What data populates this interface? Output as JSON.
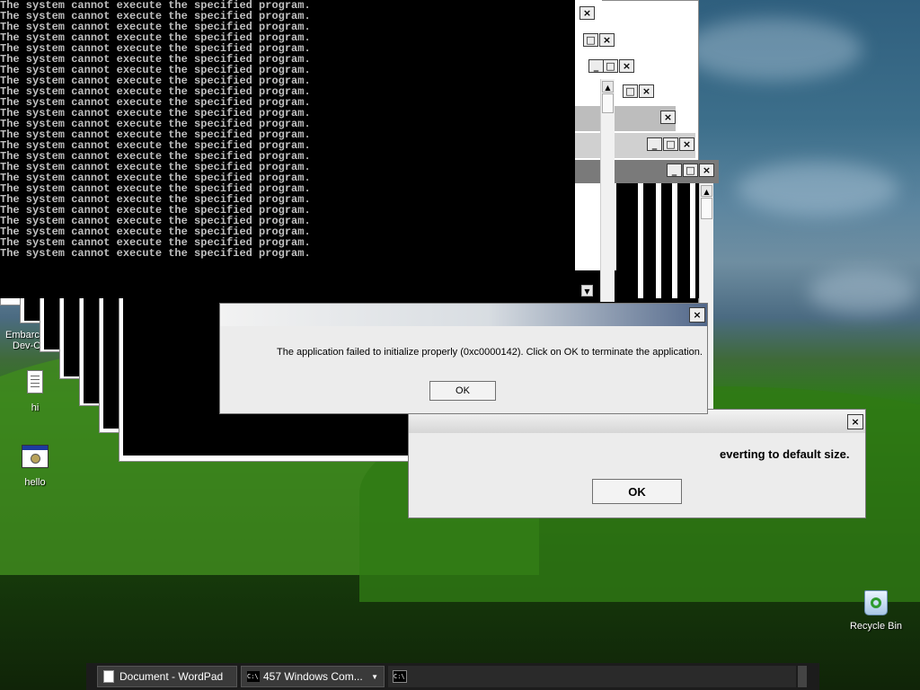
{
  "console": {
    "line": "The system cannot execute the specified program.",
    "line_count": 24
  },
  "window_controls": {
    "minimize": "_",
    "maximize": "□",
    "close": "×"
  },
  "scroll_arrows": {
    "up": "▲",
    "down": "▼"
  },
  "error_dialog": {
    "message": "The application failed to initialize properly (0xc0000142). Click on OK to terminate the application.",
    "ok_label": "OK"
  },
  "back_dialog": {
    "message_partial": "everting to default size.",
    "ok_label": "OK"
  },
  "desktop_icons": {
    "embarcadero": {
      "line1": "Embarc",
      "line2": "Dev-C"
    },
    "hi": {
      "label": "hi"
    },
    "hello": {
      "label": "hello"
    },
    "recycle_bin": {
      "label": "Recycle Bin"
    }
  },
  "taskbar": {
    "wordpad": "Document - WordPad",
    "cmd_group": "457 Windows Com...",
    "cmd_icon_text": "C:\\"
  }
}
